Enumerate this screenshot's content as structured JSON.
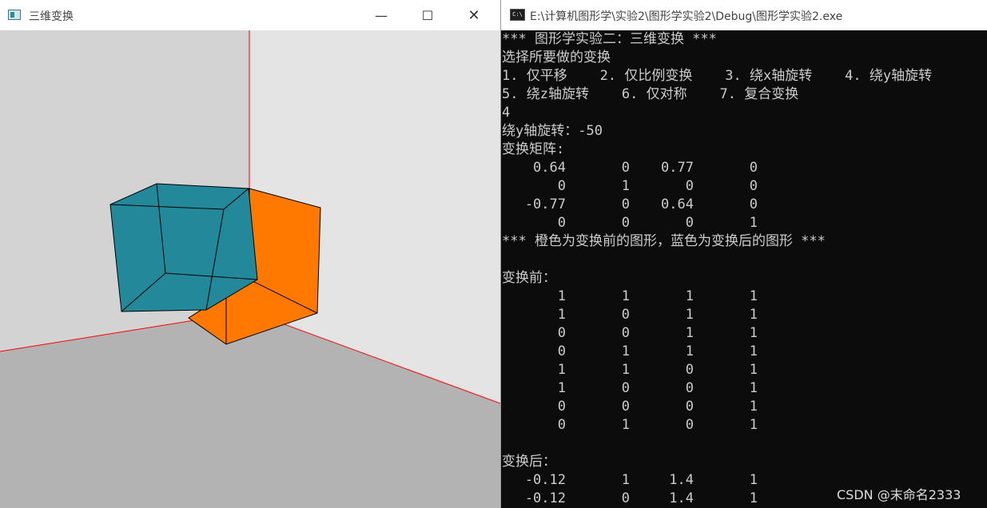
{
  "gl_window": {
    "title": "三维变换",
    "minimize_glyph": "—",
    "maximize_glyph": "☐",
    "close_glyph": "✕",
    "colors": {
      "wall_left": "#d3d3d3",
      "wall_right": "#e4e4e4",
      "floor": "#b3b3b3",
      "axis": "#ff0000",
      "original_shape": "#ff7800",
      "transformed_shape": "#23899a",
      "edge": "#000000"
    }
  },
  "console": {
    "title": "E:\\计算机图形学\\实验2\\图形学实验2\\Debug\\图形学实验2.exe",
    "text_color": "#cccccc",
    "background": "#0c0c0c",
    "header_lines": [
      "*** 图形学实验二：三维变换 ***",
      "选择所要做的变换",
      "1. 仅平移    2. 仅比例变换    3. 绕x轴旋转    4. 绕y轴旋转",
      "5. 绕z轴旋转    6. 仅对称    7. 复合变换",
      "4",
      "绕y轴旋转：-50",
      "变换矩阵:"
    ],
    "matrix": [
      [
        "0.64",
        "0",
        "0.77",
        "0"
      ],
      [
        "0",
        "1",
        "0",
        "0"
      ],
      [
        "-0.77",
        "0",
        "0.64",
        "0"
      ],
      [
        "0",
        "0",
        "0",
        "1"
      ]
    ],
    "note_line": "*** 橙色为变换前的图形，蓝色为变换后的图形 ***",
    "before_label": "变换前：",
    "before_rows": [
      [
        "1",
        "1",
        "1",
        "1"
      ],
      [
        "1",
        "0",
        "1",
        "1"
      ],
      [
        "0",
        "0",
        "1",
        "1"
      ],
      [
        "0",
        "1",
        "1",
        "1"
      ],
      [
        "1",
        "1",
        "0",
        "1"
      ],
      [
        "1",
        "0",
        "0",
        "1"
      ],
      [
        "0",
        "0",
        "0",
        "1"
      ],
      [
        "0",
        "1",
        "0",
        "1"
      ]
    ],
    "after_label": "变换后：",
    "after_rows": [
      [
        "-0.12",
        "1",
        "1.4",
        "1"
      ],
      [
        "-0.12",
        "0",
        "1.4",
        "1"
      ]
    ]
  },
  "watermark": "CSDN @末命名2333"
}
